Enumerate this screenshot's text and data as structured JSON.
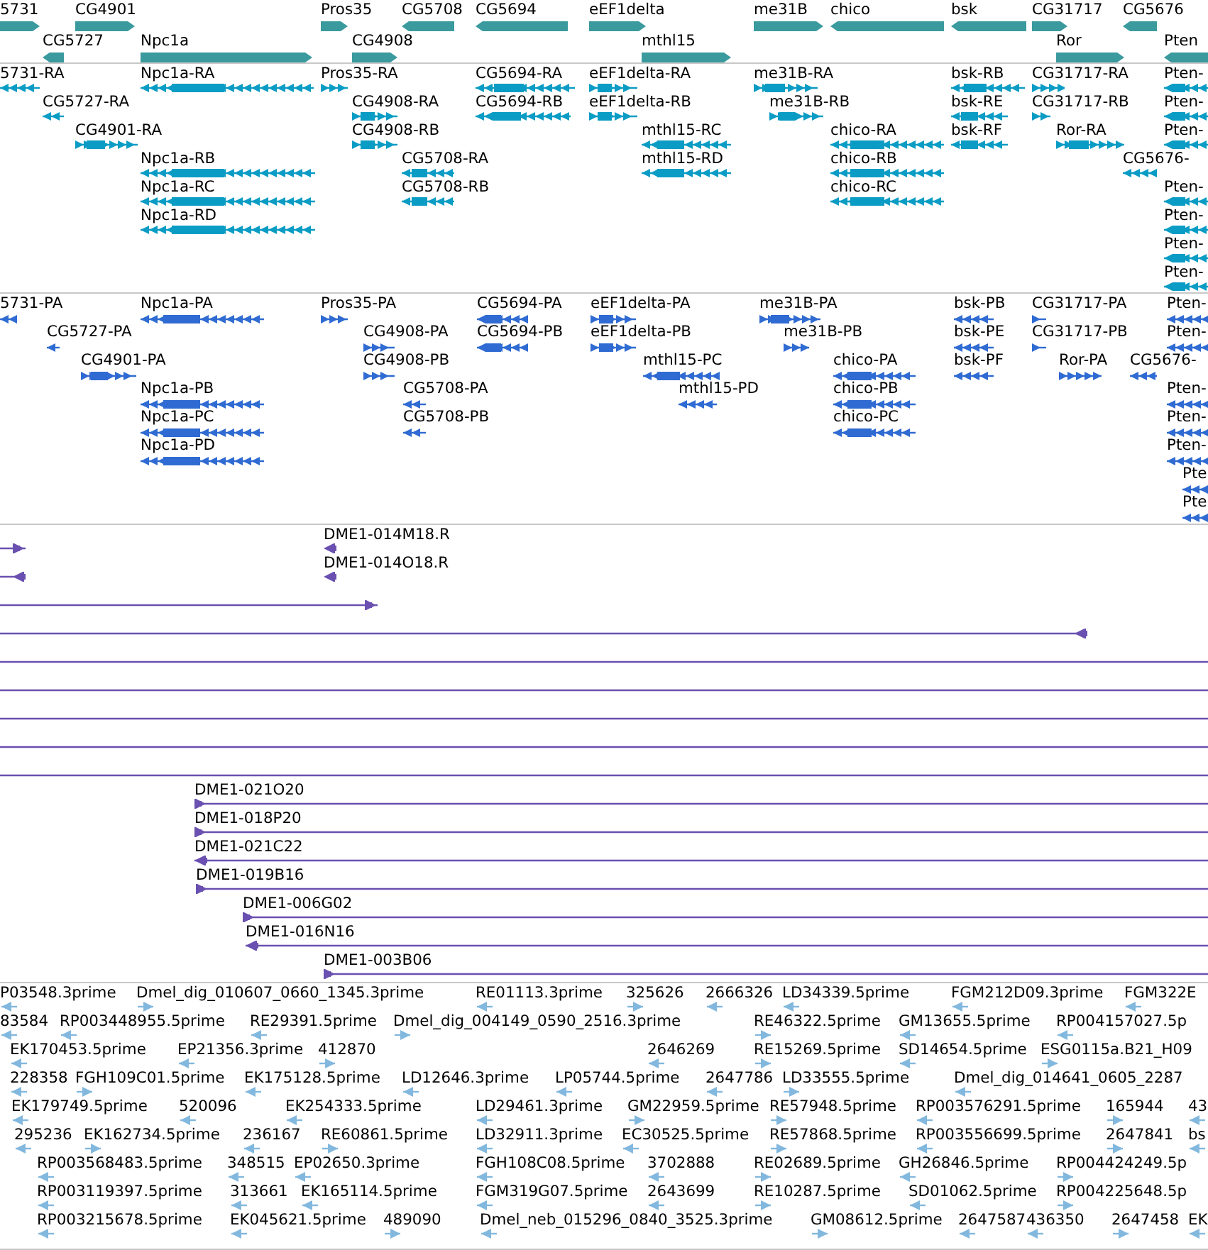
{
  "tracks": [
    {
      "kind": "gene",
      "rows": [
        {
          "features": [
            {
              "label": "5731",
              "reverse": false
            },
            {
              "label": "CG4901",
              "reverse": false
            },
            {
              "label": "Pros35",
              "reverse": false
            },
            {
              "label": "CG5708",
              "reverse": true
            },
            {
              "label": "CG5694",
              "reverse": true
            },
            {
              "label": "eEF1delta",
              "reverse": false
            },
            {
              "label": "me31B",
              "reverse": false
            },
            {
              "label": "chico",
              "reverse": true
            },
            {
              "label": "bsk",
              "reverse": true
            },
            {
              "label": "CG31717",
              "reverse": false
            },
            {
              "label": "CG5676",
              "reverse": true
            }
          ]
        },
        {
          "features": [
            {
              "label": "CG5727",
              "reverse": true
            },
            {
              "label": "Npc1a",
              "reverse": false
            },
            {
              "label": "CG4908",
              "reverse": false
            },
            {
              "label": "mthl15",
              "reverse": false
            },
            {
              "label": "Ror",
              "reverse": false
            },
            {
              "label": "Pten",
              "reverse": true
            }
          ]
        }
      ]
    },
    {
      "kind": "transcript",
      "rows": [
        {
          "features": [
            {
              "label": "5731-RA",
              "reverse": true
            },
            {
              "label": "Npc1a-RA",
              "reverse": true
            },
            {
              "label": "Pros35-RA",
              "reverse": false
            },
            {
              "label": "CG5694-RA",
              "reverse": true
            },
            {
              "label": "eEF1delta-RA",
              "reverse": false
            },
            {
              "label": "me31B-RA",
              "reverse": false
            },
            {
              "label": "bsk-RB",
              "reverse": true
            },
            {
              "label": "CG31717-RA",
              "reverse": false
            },
            {
              "label": "Pten-",
              "reverse": true
            }
          ]
        },
        {
          "features": [
            {
              "label": "CG5727-RA",
              "reverse": true
            },
            {
              "label": "CG4908-RA",
              "reverse": false
            },
            {
              "label": "CG5694-RB",
              "reverse": true
            },
            {
              "label": "eEF1delta-RB",
              "reverse": false
            },
            {
              "label": "me31B-RB",
              "reverse": false
            },
            {
              "label": "bsk-RE",
              "reverse": true
            },
            {
              "label": "CG31717-RB",
              "reverse": false
            },
            {
              "label": "Pten-",
              "reverse": true
            }
          ]
        },
        {
          "features": [
            {
              "label": "CG4901-RA",
              "reverse": false
            },
            {
              "label": "CG4908-RB",
              "reverse": false
            },
            {
              "label": "mthl15-RC",
              "reverse": true
            },
            {
              "label": "chico-RA",
              "reverse": true
            },
            {
              "label": "bsk-RF",
              "reverse": true
            },
            {
              "label": "Ror-RA",
              "reverse": false
            },
            {
              "label": "Pten-",
              "reverse": true
            }
          ]
        },
        {
          "features": [
            {
              "label": "Npc1a-RB",
              "reverse": true
            },
            {
              "label": "CG5708-RA",
              "reverse": true
            },
            {
              "label": "mthl15-RD",
              "reverse": true
            },
            {
              "label": "chico-RB",
              "reverse": true
            },
            {
              "label": "CG5676-",
              "reverse": true
            }
          ]
        },
        {
          "features": [
            {
              "label": "Npc1a-RC",
              "reverse": true
            },
            {
              "label": "CG5708-RB",
              "reverse": true
            },
            {
              "label": "chico-RC",
              "reverse": true
            },
            {
              "label": "Pten-",
              "reverse": true
            }
          ]
        },
        {
          "features": [
            {
              "label": "Npc1a-RD",
              "reverse": true
            },
            {
              "label": "Pten-",
              "reverse": true
            }
          ]
        },
        {
          "features": [
            {
              "label": "Pten-",
              "reverse": true
            }
          ]
        },
        {
          "features": [
            {
              "label": "Pten-",
              "reverse": true
            }
          ]
        }
      ]
    },
    {
      "kind": "polypeptide",
      "rows": [
        {
          "features": [
            {
              "label": "5731-PA",
              "reverse": true
            },
            {
              "label": "Npc1a-PA",
              "reverse": true
            },
            {
              "label": "Pros35-PA",
              "reverse": false
            },
            {
              "label": "CG5694-PA",
              "reverse": true
            },
            {
              "label": "eEF1delta-PA",
              "reverse": false
            },
            {
              "label": "me31B-PA",
              "reverse": false
            },
            {
              "label": "bsk-PB",
              "reverse": true
            },
            {
              "label": "CG31717-PA",
              "reverse": false
            },
            {
              "label": "Pten-",
              "reverse": true
            }
          ]
        },
        {
          "features": [
            {
              "label": "CG5727-PA",
              "reverse": true
            },
            {
              "label": "CG4908-PA",
              "reverse": false
            },
            {
              "label": "CG5694-PB",
              "reverse": true
            },
            {
              "label": "eEF1delta-PB",
              "reverse": false
            },
            {
              "label": "me31B-PB",
              "reverse": false
            },
            {
              "label": "bsk-PE",
              "reverse": true
            },
            {
              "label": "CG31717-PB",
              "reverse": false
            },
            {
              "label": "Pten-",
              "reverse": true
            }
          ]
        },
        {
          "features": [
            {
              "label": "CG4901-PA",
              "reverse": false
            },
            {
              "label": "CG4908-PB",
              "reverse": false
            },
            {
              "label": "mthl15-PC",
              "reverse": true
            },
            {
              "label": "chico-PA",
              "reverse": true
            },
            {
              "label": "bsk-PF",
              "reverse": true
            },
            {
              "label": "Ror-PA",
              "reverse": false
            },
            {
              "label": "CG5676-",
              "reverse": true
            }
          ]
        },
        {
          "features": [
            {
              "label": "Npc1a-PB",
              "reverse": true
            },
            {
              "label": "CG5708-PA",
              "reverse": true
            },
            {
              "label": "mthl15-PD",
              "reverse": true
            },
            {
              "label": "chico-PB",
              "reverse": true
            },
            {
              "label": "Pten-",
              "reverse": true
            }
          ]
        },
        {
          "features": [
            {
              "label": "Npc1a-PC",
              "reverse": true
            },
            {
              "label": "CG5708-PB",
              "reverse": true
            },
            {
              "label": "chico-PC",
              "reverse": true
            },
            {
              "label": "Pten-",
              "reverse": true
            }
          ]
        },
        {
          "features": [
            {
              "label": "Npc1a-PD",
              "reverse": true
            },
            {
              "label": "Pten-",
              "reverse": true
            }
          ]
        },
        {
          "features": [
            {
              "label": "Pte",
              "reverse": true
            }
          ]
        },
        {
          "features": [
            {
              "label": "Pte",
              "reverse": true
            }
          ]
        }
      ]
    },
    {
      "kind": "clone",
      "rows": [
        {
          "features": [
            {
              "kind": "clone",
              "reverse": false
            },
            {
              "kind": "clone",
              "label": "DME1-014M18.R",
              "reverse": true
            }
          ]
        },
        {
          "features": [
            {
              "kind": "clone",
              "reverse": true
            },
            {
              "kind": "clone",
              "label": "DME1-014O18.R",
              "reverse": true
            }
          ]
        },
        {
          "features": [
            {
              "kind": "clone",
              "reverse": false
            }
          ]
        },
        {
          "features": [
            {
              "kind": "clone",
              "reverse": true
            }
          ]
        },
        {
          "features": [
            {
              "kind": "line"
            }
          ]
        },
        {
          "features": [
            {
              "kind": "line"
            }
          ]
        },
        {
          "features": [
            {
              "kind": "line"
            }
          ]
        },
        {
          "features": [
            {
              "kind": "line"
            }
          ]
        },
        {
          "features": [
            {
              "kind": "line"
            }
          ]
        },
        {
          "features": [
            {
              "kind": "clone",
              "label": "DME1-021O20",
              "reverse": false
            }
          ]
        },
        {
          "features": [
            {
              "kind": "clone",
              "label": "DME1-018P20",
              "reverse": false
            }
          ]
        },
        {
          "features": [
            {
              "kind": "clone",
              "label": "DME1-021C22",
              "reverse": true
            }
          ]
        },
        {
          "features": [
            {
              "kind": "clone",
              "label": "DME1-019B16",
              "reverse": false
            }
          ]
        },
        {
          "features": [
            {
              "kind": "clone",
              "label": "DME1-006G02",
              "reverse": false
            }
          ]
        },
        {
          "features": [
            {
              "kind": "clone",
              "label": "DME1-016N16",
              "reverse": true
            }
          ]
        },
        {
          "features": [
            {
              "kind": "clone",
              "label": "DME1-003B06",
              "reverse": false
            }
          ]
        }
      ]
    },
    {
      "kind": "est",
      "rows": [
        {
          "features": [
            {
              "label": "P03548.3prime",
              "reverse": true
            },
            {
              "label": "Dmel_dig_010607_0660_1345.3prime",
              "reverse": false
            },
            {
              "label": "RE01113.3prime",
              "reverse": true
            },
            {
              "label": "325626",
              "reverse": false
            },
            {
              "label": "2666326",
              "reverse": true
            },
            {
              "label": "LD34339.5prime",
              "reverse": true
            },
            {
              "label": "FGM212D09.3prime",
              "reverse": true
            },
            {
              "label": "FGM322E",
              "reverse": true
            }
          ]
        },
        {
          "features": [
            {
              "label": "83584",
              "reverse": true
            },
            {
              "label": "RP003448955.5prime",
              "reverse": true
            },
            {
              "label": "RE29391.5prime",
              "reverse": true
            },
            {
              "label": "Dmel_dig_004149_0590_2516.3prime",
              "reverse": false
            },
            {
              "label": "RE46322.5prime",
              "reverse": false
            },
            {
              "label": "GM13655.5prime",
              "reverse": true
            },
            {
              "label": "RP004157027.5p",
              "reverse": true
            }
          ]
        },
        {
          "features": [
            {
              "label": "EK170453.5prime",
              "reverse": true
            },
            {
              "label": "EP21356.3prime",
              "reverse": true
            },
            {
              "label": "412870",
              "reverse": false
            },
            {
              "label": "2646269",
              "reverse": true
            },
            {
              "label": "RE15269.5prime",
              "reverse": false
            },
            {
              "label": "SD14654.5prime",
              "reverse": true
            },
            {
              "label": "ESG0115a.B21_H09",
              "reverse": false
            }
          ]
        },
        {
          "features": [
            {
              "label": "228358",
              "reverse": true
            },
            {
              "label": "FGH109C01.5prime",
              "reverse": false
            },
            {
              "label": "EK175128.5prime",
              "reverse": true
            },
            {
              "label": "LD12646.3prime",
              "reverse": true
            },
            {
              "label": "LP05744.5prime",
              "reverse": true
            },
            {
              "label": "2647786",
              "reverse": true
            },
            {
              "label": "LD33555.5prime",
              "reverse": false
            },
            {
              "label": "Dmel_dig_014641_0605_2287",
              "reverse": true
            }
          ]
        },
        {
          "features": [
            {
              "label": "EK179749.5prime",
              "reverse": true
            },
            {
              "label": "520096",
              "reverse": true
            },
            {
              "label": "EK254333.5prime",
              "reverse": true
            },
            {
              "label": "LD29461.3prime",
              "reverse": true
            },
            {
              "label": "GM22959.5prime",
              "reverse": false
            },
            {
              "label": "RE57948.5prime",
              "reverse": false
            },
            {
              "label": "RP003576291.5prime",
              "reverse": true
            },
            {
              "label": "165944",
              "reverse": false
            },
            {
              "label": "43",
              "reverse": true
            }
          ]
        },
        {
          "features": [
            {
              "label": "295236",
              "reverse": true
            },
            {
              "label": "EK162734.5prime",
              "reverse": false
            },
            {
              "label": "236167",
              "reverse": true
            },
            {
              "label": "RE60861.5prime",
              "reverse": false
            },
            {
              "label": "LD32911.3prime",
              "reverse": true
            },
            {
              "label": "EC30525.5prime",
              "reverse": true
            },
            {
              "label": "RE57868.5prime",
              "reverse": false
            },
            {
              "label": "RP003556699.5prime",
              "reverse": true
            },
            {
              "label": "2647841",
              "reverse": false
            },
            {
              "label": "bs",
              "reverse": true
            }
          ]
        },
        {
          "features": [
            {
              "label": "RP003568483.5prime",
              "reverse": true
            },
            {
              "label": "348515",
              "reverse": true
            },
            {
              "label": "EP02650.3prime",
              "reverse": true
            },
            {
              "label": "FGH108C08.5prime",
              "reverse": true
            },
            {
              "label": "3702888",
              "reverse": true
            },
            {
              "label": "RE02689.5prime",
              "reverse": false
            },
            {
              "label": "GH26846.5prime",
              "reverse": true
            },
            {
              "label": "RP004424249.5p",
              "reverse": false
            }
          ]
        },
        {
          "features": [
            {
              "label": "RP003119397.5prime",
              "reverse": true
            },
            {
              "label": "313661",
              "reverse": true
            },
            {
              "label": "EK165114.5prime",
              "reverse": true
            },
            {
              "label": "FGM319G07.5prime",
              "reverse": true
            },
            {
              "label": "2643699",
              "reverse": true
            },
            {
              "label": "RE10287.5prime",
              "reverse": false
            },
            {
              "label": "SD01062.5prime",
              "reverse": true
            },
            {
              "label": "RP004225648.5p",
              "reverse": false
            }
          ]
        },
        {
          "features": [
            {
              "label": "RP003215678.5prime",
              "reverse": true
            },
            {
              "label": "EK045621.5prime",
              "reverse": true
            },
            {
              "label": "489090",
              "reverse": false
            },
            {
              "label": "Dmel_neb_015296_0840_3525.3prime",
              "reverse": true
            },
            {
              "label": "GM08612.5prime",
              "reverse": false
            },
            {
              "label": "2647587",
              "reverse": true
            },
            {
              "label": "436350",
              "reverse": true
            },
            {
              "label": "2647458",
              "reverse": false
            },
            {
              "label": "EK",
              "reverse": true
            }
          ]
        }
      ]
    }
  ]
}
